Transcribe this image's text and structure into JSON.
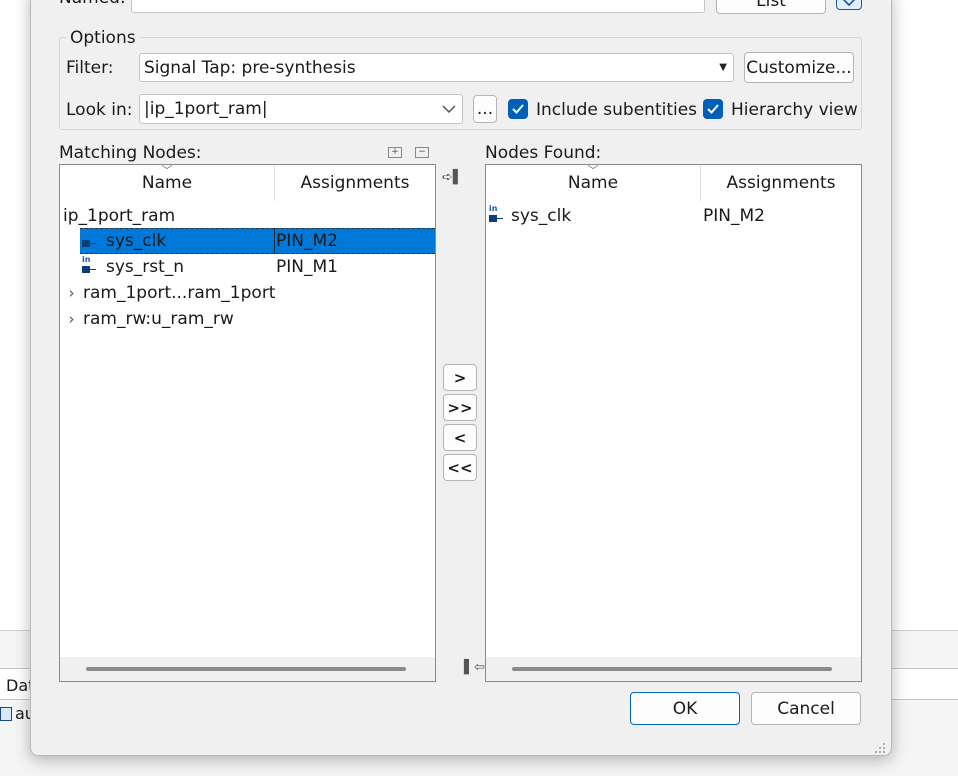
{
  "background": {
    "tab_label": "Dat",
    "item_label": "au"
  },
  "top": {
    "named_label": "Named:",
    "named_value": "",
    "list_button": "List"
  },
  "options": {
    "group_title": "Options",
    "filter_label": "Filter:",
    "filter_value": "Signal Tap: pre-synthesis",
    "customize_button": "Customize...",
    "lookin_label": "Look in:",
    "lookin_value": "|ip_1port_ram|",
    "browse_button": "...",
    "include_subentities": "Include subentities",
    "hierarchy_view": "Hierarchy view"
  },
  "matching": {
    "title": "Matching Nodes:",
    "col_name": "Name",
    "col_assign": "Assignments",
    "rows": [
      {
        "name": "ip_1port_ram",
        "assign": ""
      },
      {
        "name": "sys_clk",
        "assign": "PIN_M2"
      },
      {
        "name": "sys_rst_n",
        "assign": "PIN_M1"
      },
      {
        "name": "ram_1port...ram_1port",
        "assign": ""
      },
      {
        "name": "ram_rw:u_ram_rw",
        "assign": ""
      }
    ]
  },
  "found": {
    "title": "Nodes Found:",
    "col_name": "Name",
    "col_assign": "Assignments",
    "rows": [
      {
        "name": "sys_clk",
        "assign": "PIN_M2"
      }
    ]
  },
  "move": {
    "add": ">",
    "add_all": ">>",
    "remove": "<",
    "remove_all": "<<"
  },
  "icons": {
    "pin_badge": "in"
  },
  "footer": {
    "ok": "OK",
    "cancel": "Cancel"
  },
  "colors": {
    "accent": "#0078d7",
    "checkbox": "#005fb8",
    "pin_icon": "#0b3d7a"
  }
}
